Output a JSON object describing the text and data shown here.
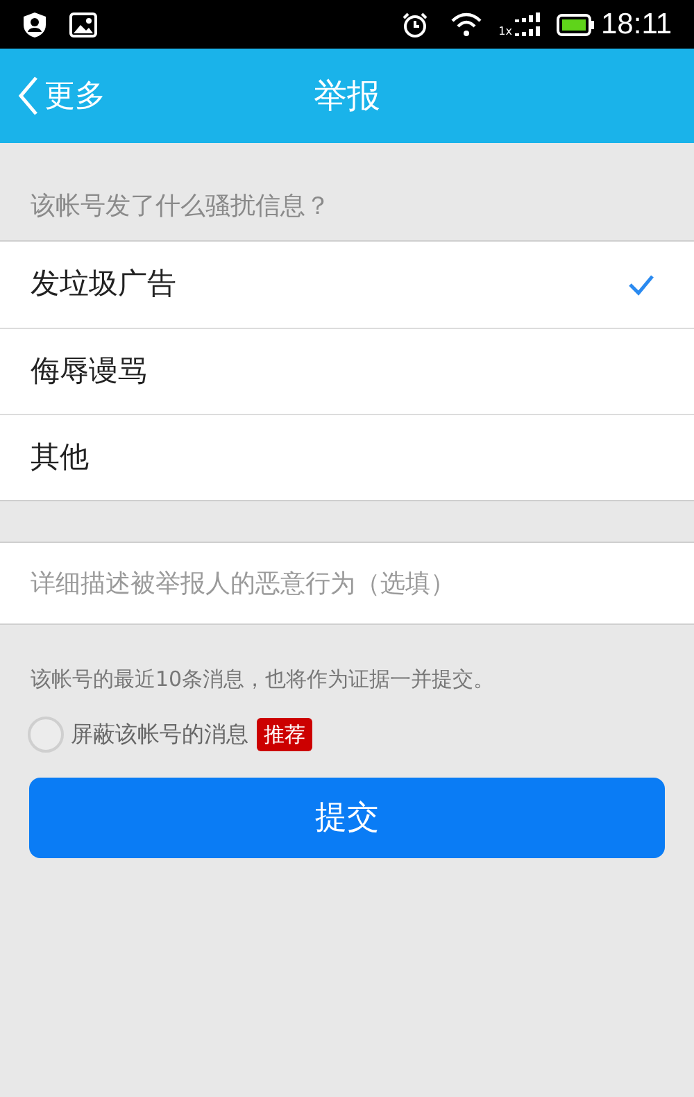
{
  "status_bar": {
    "signal_label": "1x",
    "time": "18:11"
  },
  "header": {
    "back": "更多",
    "title": "举报"
  },
  "section_label": "该帐号发了什么骚扰信息？",
  "options": [
    {
      "label": "发垃圾广告",
      "selected": true
    },
    {
      "label": "侮辱谩骂",
      "selected": false
    },
    {
      "label": "其他",
      "selected": false
    }
  ],
  "detail_field": {
    "placeholder": "详细描述被举报人的恶意行为（选填）"
  },
  "note": "该帐号的最近10条消息，也将作为证据一并提交。",
  "block_option": {
    "label": "屏蔽该帐号的消息",
    "checked": false,
    "badge": "推荐"
  },
  "submit": "提交"
}
